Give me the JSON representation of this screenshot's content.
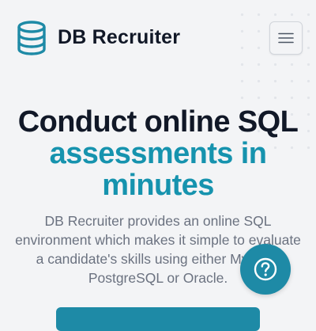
{
  "header": {
    "brand": "DB Recruiter",
    "logo_icon": "database-icon",
    "menu_icon": "hamburger-menu-icon"
  },
  "hero": {
    "title_line1": "Conduct online SQL",
    "title_line2": "assessments in minutes",
    "description": "DB Recruiter provides an online SQL environment which makes it simple to evaluate a candidate's skills using either MySQL, PostgreSQL or Oracle."
  },
  "help": {
    "icon": "help-question-icon"
  },
  "colors": {
    "accent": "#1e8aa6",
    "title_accent": "#1693ae",
    "heading": "#111827",
    "body_text": "#6b7280",
    "background": "#f3f4f6"
  }
}
